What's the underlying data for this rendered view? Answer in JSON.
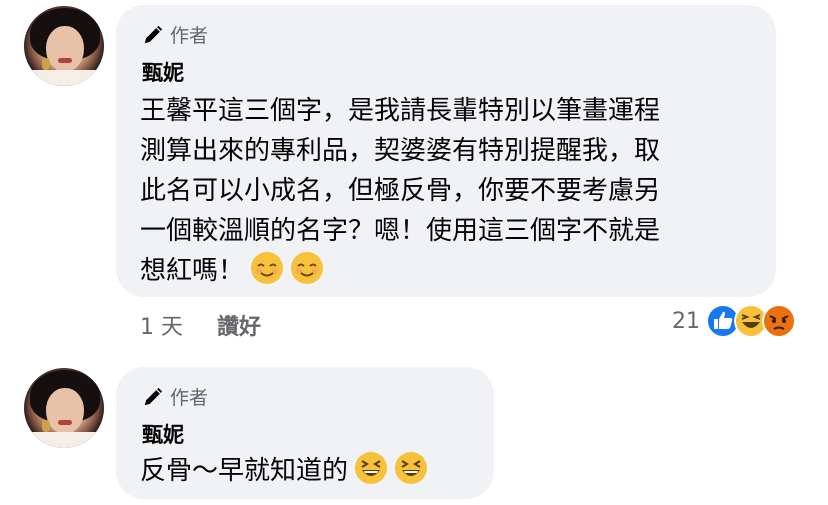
{
  "comments": [
    {
      "author_badge": "作者",
      "name": "甄妮",
      "text": "王馨平這三個字，是我請長輩特別以筆畫運程\n測算出來的專利品，契婆婆有特別提醒我，取\n此名可以小成名，但極反骨，你要不要考慮另\n一個較溫順的名字？嗯！使用這三個字不就是\n想紅嗎！",
      "emojis": [
        "smiling-face-icon",
        "smiling-face-icon"
      ],
      "time": "1 天",
      "like_label": "讚好",
      "reaction_count": "21",
      "reactions": [
        "like-reaction-icon",
        "haha-reaction-icon",
        "angry-reaction-icon"
      ]
    },
    {
      "author_badge": "作者",
      "name": "甄妮",
      "text": "反骨～早就知道的",
      "emojis": [
        "grinning-squinting-face-icon",
        "grinning-squinting-face-icon"
      ]
    }
  ],
  "colors": {
    "bubble": "#f0f2f5",
    "secondary_text": "#65676b",
    "like_blue": "#1877f2",
    "emoji_yellow": "#f7c23a",
    "angry_red": "#e9710f"
  }
}
